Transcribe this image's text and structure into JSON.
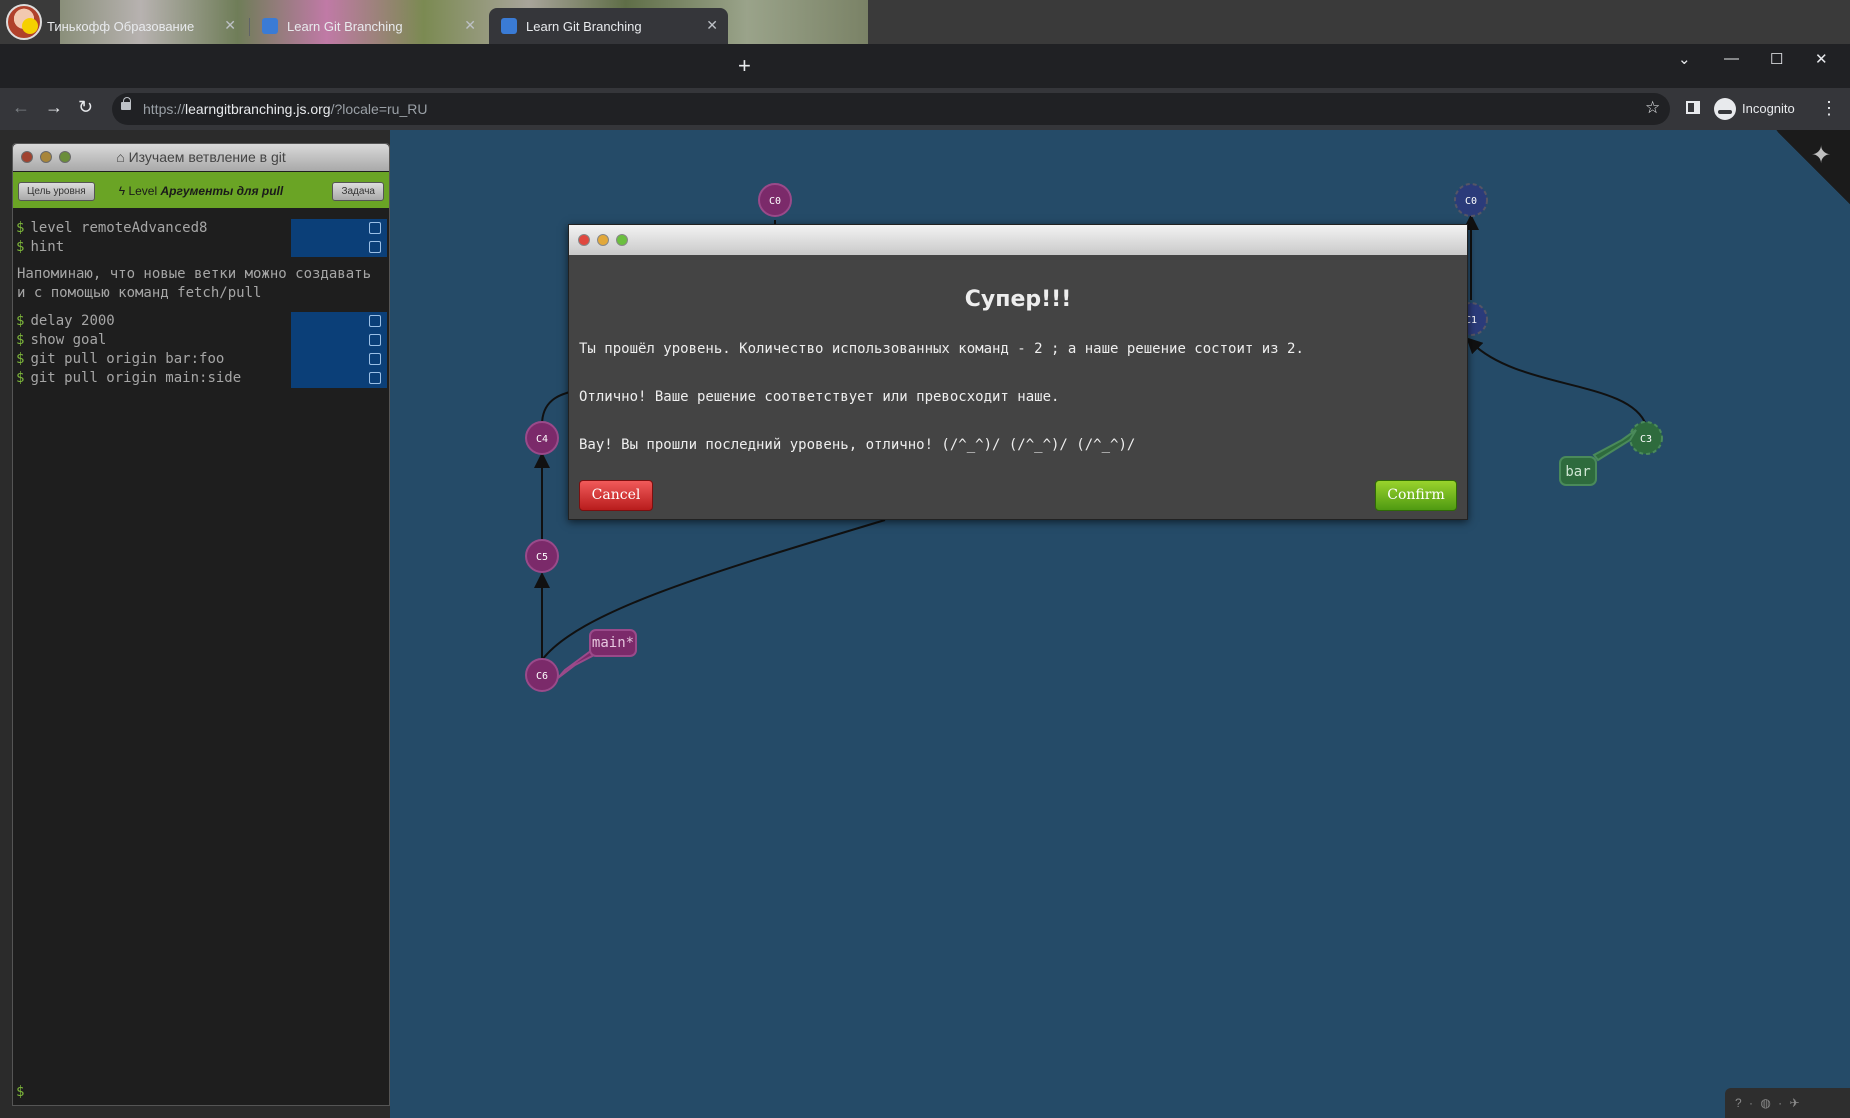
{
  "browser": {
    "tabs": [
      {
        "label": "Тинькофф Образование",
        "active": false
      },
      {
        "label": "Learn Git Branching",
        "active": false
      },
      {
        "label": "Learn Git Branching",
        "active": true
      }
    ],
    "url_host": "learngitbranching.js.org",
    "url_prefix": "https://",
    "url_path": "/?locale=ru_RU",
    "incognito_label": "Incognito"
  },
  "terminal": {
    "title": "Изучаем ветвление в git",
    "goal_button": "Цель уровня",
    "task_button": "Задача",
    "level_prefix": "Level",
    "level_name": "Аргументы для pull",
    "commands_a": [
      "level remoteAdvanced8",
      "hint"
    ],
    "hint_text": "Напоминаю, что новые ветки можно создавать и с помощью команд fetch/pull",
    "commands_b": [
      "delay 2000",
      "show goal",
      "git pull origin bar:foo",
      "git pull origin main:side"
    ],
    "prompt": "$"
  },
  "graph": {
    "colors": {
      "local": "#7b2a6a",
      "remote": "#2b3b7a",
      "remote_branch": "#2e6b3d"
    },
    "commits": [
      "C0",
      "C4",
      "C5",
      "C6",
      "C0",
      "C1",
      "C3"
    ],
    "branches": [
      "main*",
      "bar"
    ]
  },
  "modal": {
    "title": "Супер!!!",
    "line1": "Ты прошёл уровень. Количество использованных команд - 2 ; а наше решение состоит из 2.",
    "line2": "Отлично! Ваше решение соответствует или превосходит наше.",
    "line3": "Вау! Вы прошли последний уровень, отлично! (/^_^)/ (/^_^)/ (/^_^)/",
    "cancel": "Cancel",
    "confirm": "Confirm"
  }
}
